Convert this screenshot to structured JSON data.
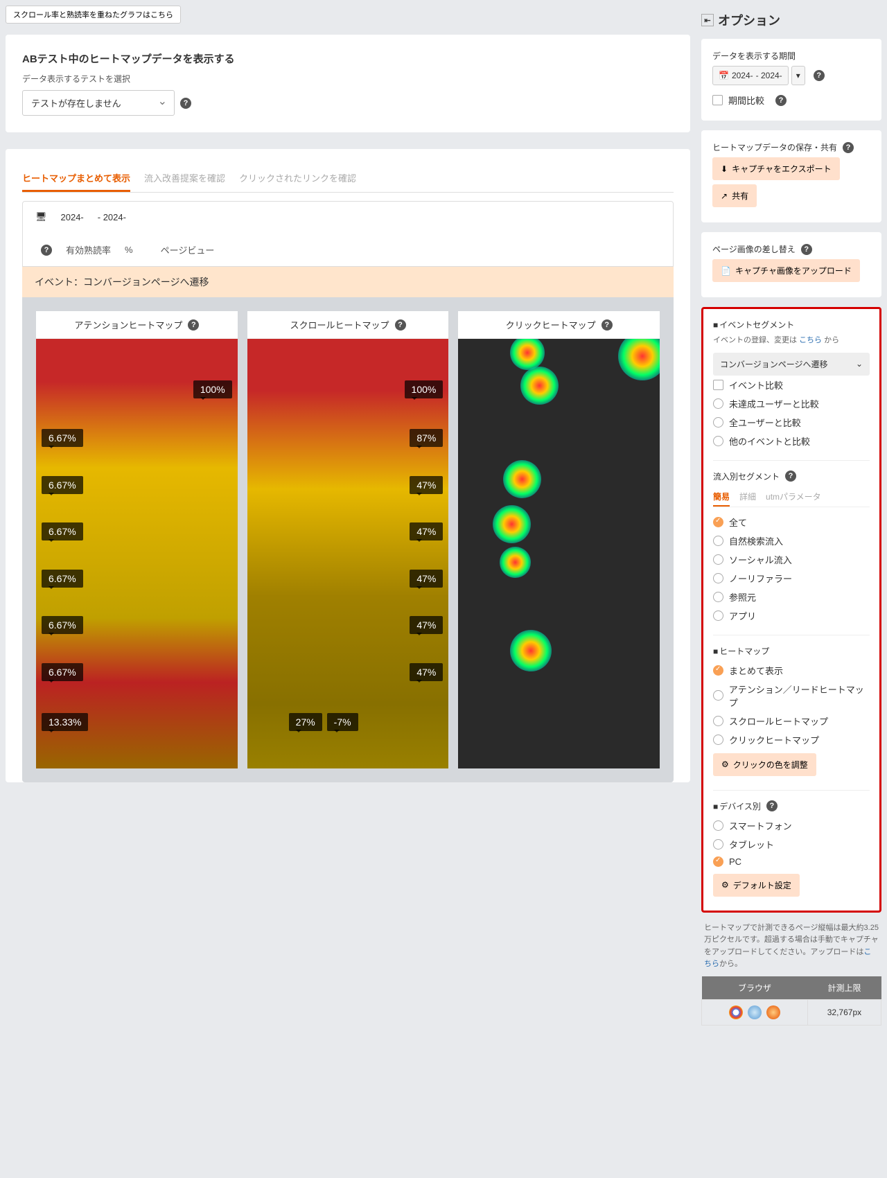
{
  "top_button": "スクロール率と熟読率を重ねたグラフはこちら",
  "ab_card": {
    "title": "ABテスト中のヒートマップデータを表示する",
    "subtitle": "データ表示するテストを選択",
    "select_value": "テストが存在しません"
  },
  "tabs": {
    "t1": "ヒートマップまとめて表示",
    "t2": "流入改善提案を確認",
    "t3": "クリックされたリンクを確認"
  },
  "info": {
    "date_from": "2024-",
    "date_to": "- 2024-",
    "read_label": "有効熟読率",
    "read_unit": "%",
    "pv_label": "ページビュー"
  },
  "event_bar": "イベント：コンバージョンページへ遷移",
  "hm": {
    "attention_title": "アテンションヒートマップ",
    "scroll_title": "スクロールヒートマップ",
    "click_title": "クリックヒートマップ",
    "attention_vals": [
      "100%",
      "6.67%",
      "6.67%",
      "6.67%",
      "6.67%",
      "6.67%",
      "6.67%",
      "13.33%"
    ],
    "scroll_vals": [
      "100%",
      "87%",
      "47%",
      "47%",
      "47%",
      "47%",
      "47%",
      "27%",
      "-7%"
    ]
  },
  "sidebar": {
    "title": "オプション",
    "period_label": "データを表示する期間",
    "date1": "2024-",
    "date2": "- 2024-",
    "period_compare": "期間比較",
    "save_label": "ヒートマップデータの保存・共有",
    "btn_export": "キャプチャをエクスポート",
    "btn_share": "共有",
    "img_swap_label": "ページ画像の差し替え",
    "btn_upload": "キャプチャ画像をアップロード",
    "event_seg": {
      "heading": "イベントセグメント",
      "sub_pre": "イベントの登録、変更は ",
      "sub_link": "こちら",
      "sub_post": " から",
      "select": "コンバージョンページへ遷移",
      "chk_compare": "イベント比較",
      "r1": "未達成ユーザーと比較",
      "r2": "全ユーザーと比較",
      "r3": "他のイベントと比較"
    },
    "inflow": {
      "heading": "流入別セグメント",
      "tab1": "簡易",
      "tab2": "詳細",
      "tab3": "utmパラメータ",
      "o1": "全て",
      "o2": "自然検索流入",
      "o3": "ソーシャル流入",
      "o4": "ノーリファラー",
      "o5": "参照元",
      "o6": "アプリ"
    },
    "heatmap": {
      "heading": "ヒートマップ",
      "o1": "まとめて表示",
      "o2": "アテンション／リードヒートマップ",
      "o3": "スクロールヒートマップ",
      "o4": "クリックヒートマップ",
      "btn": "クリックの色を調整"
    },
    "device": {
      "heading": "デバイス別",
      "o1": "スマートフォン",
      "o2": "タブレット",
      "o3": "PC",
      "btn": "デフォルト設定"
    },
    "note_pre": "ヒートマップで計測できるページ縦幅は最大約3.25万ピクセルです。超過する場合は手動でキャプチャをアップロードしてください。アップロードは",
    "note_link": "こちら",
    "note_post": "から。",
    "table": {
      "th1": "ブラウザ",
      "th2": "計測上限",
      "limit": "32,767px"
    }
  }
}
